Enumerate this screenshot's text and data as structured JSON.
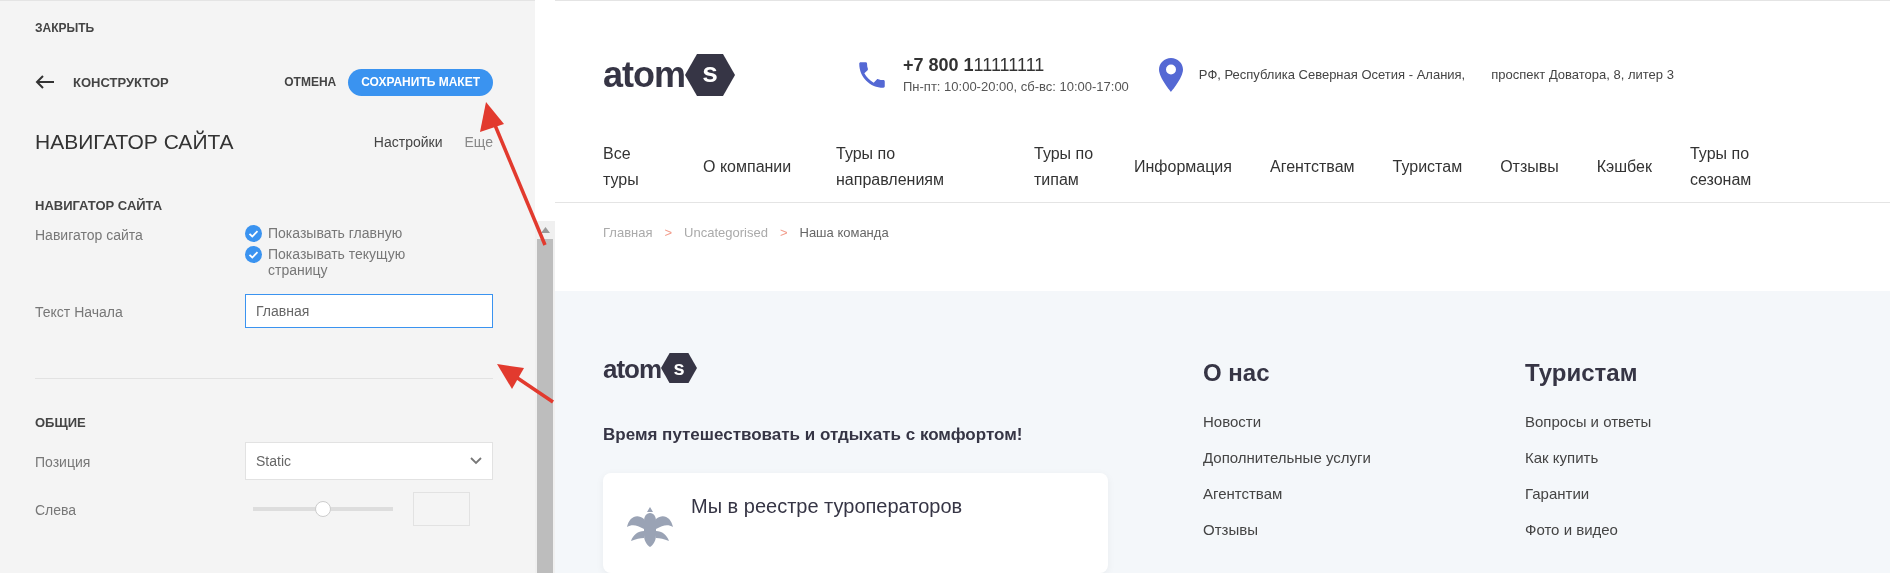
{
  "panel": {
    "close": "ЗАКРЫТЬ",
    "back_title": "КОНСТРУКТОР",
    "cancel": "ОТМЕНА",
    "save": "СОХРАНИТЬ МАКЕТ",
    "title": "НАВИГАТОР САЙТА",
    "tabs": [
      {
        "label": "Настройки",
        "selected": true
      },
      {
        "label": "Еще",
        "selected": false
      }
    ],
    "sections": [
      {
        "heading": "НАВИГАТОР САЙТА",
        "rows": [
          {
            "kind": "checkboxes",
            "label": "Навигатор сайта",
            "options": [
              {
                "label": "Показывать главную",
                "checked": true
              },
              {
                "label": "Показывать текущую страницу",
                "checked": true
              }
            ]
          },
          {
            "kind": "text",
            "label": "Текст Начала",
            "value": "Главная",
            "focused": true
          }
        ]
      },
      {
        "heading": "ОБЩИЕ",
        "rows": [
          {
            "kind": "select",
            "label": "Позиция",
            "value": "Static"
          },
          {
            "kind": "slider",
            "label": "Слева",
            "level": 0.5
          }
        ]
      }
    ]
  },
  "site": {
    "logo": {
      "word": "atom",
      "badge": "s"
    },
    "phone": "**+7 800 1**11111111",
    "hours": "Пн-пт: 10:00-20:00, сб-вс: 10:00-17:00",
    "address": [
      "РФ, Республика Северная Осетия - Алания,",
      "проспект Доватора, 8, литер 3"
    ],
    "nav": [
      "Все туры",
      "О компании",
      "Туры по направлениям",
      "Туры по типам",
      "Информация",
      "Агентствам",
      "Туристам",
      "Отзывы",
      "Кэшбек",
      "Туры по сезонам"
    ],
    "breadcrumb": {
      "separator": ">",
      "items": [
        {
          "label": "Главная",
          "current": false
        },
        {
          "label": "Uncategorised",
          "current": false
        },
        {
          "label": "Наша команда",
          "current": true
        }
      ]
    },
    "footer": {
      "logo": {
        "word": "atom",
        "badge": "s"
      },
      "tagline": "Время путешествовать и отдыхать с комфортом!",
      "card": "Мы в реестре туроператоров",
      "columns": [
        {
          "heading": "О нас",
          "links": [
            "Новости",
            "Дополнительные услуги",
            "Агентствам",
            "Отзывы"
          ]
        },
        {
          "heading": "Туристам",
          "links": [
            "Вопросы и ответы",
            "Как купить",
            "Гарантии",
            "Фото и видео"
          ]
        }
      ]
    }
  }
}
